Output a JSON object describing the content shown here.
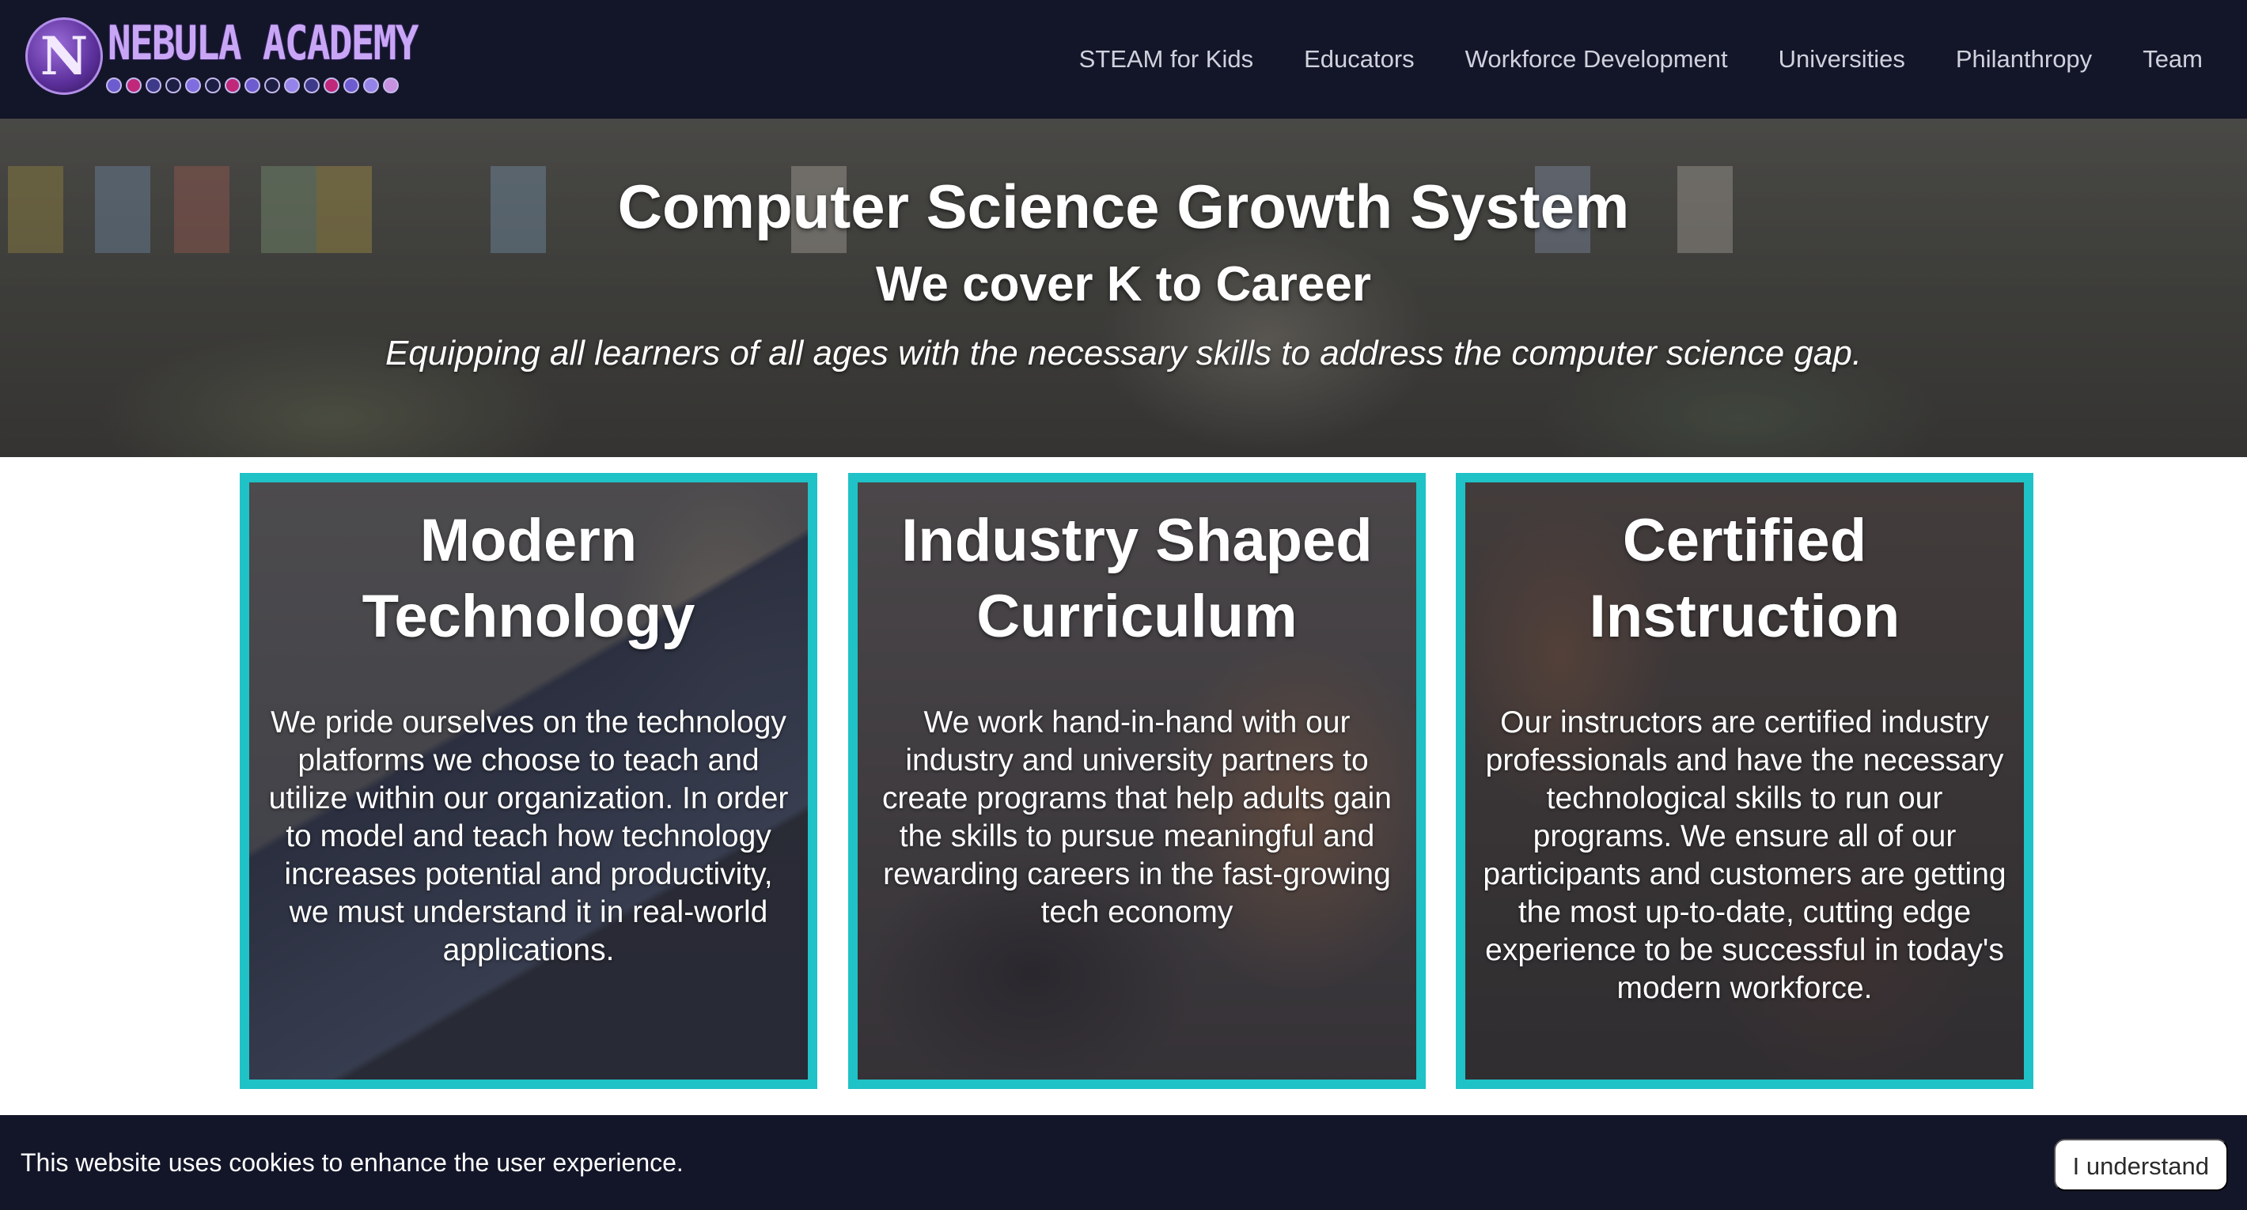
{
  "brand": {
    "logo_letter": "N",
    "name": "NEBULA ACADEMY"
  },
  "nav": {
    "items": [
      {
        "label": "STEAM for Kids"
      },
      {
        "label": "Educators"
      },
      {
        "label": "Workforce Development"
      },
      {
        "label": "Universities"
      },
      {
        "label": "Philanthropy"
      },
      {
        "label": "Team"
      }
    ]
  },
  "hero": {
    "title": "Computer Science Growth System",
    "subtitle": "We cover K to Career",
    "tagline": "Equipping all learners of all ages with the necessary skills to address the computer science gap."
  },
  "cards": [
    {
      "title": "Modern Technology",
      "body": "We pride ourselves on the technology platforms we choose to teach and utilize within our organization. In order to model and teach how technology increases potential and productivity, we must understand it in real-world applications."
    },
    {
      "title": "Industry Shaped Curriculum",
      "body": "We work hand-in-hand with our industry and university partners to create programs that help adults gain the skills to pursue meaningful and rewarding careers in the fast-growing tech economy"
    },
    {
      "title": "Certified Instruction",
      "body": "Our instructors are certified industry professionals and have the necessary technological skills to run our programs. We ensure all of our participants and customers are getting the most up-to-date, cutting edge experience to be successful in today's modern workforce."
    }
  ],
  "cookie": {
    "message": "This website uses cookies to enhance the user experience.",
    "button_label": "I understand"
  },
  "colors": {
    "nav_bg": "#131529",
    "card_border": "#1fc2c6",
    "logo_text": "#c9a6f5"
  }
}
